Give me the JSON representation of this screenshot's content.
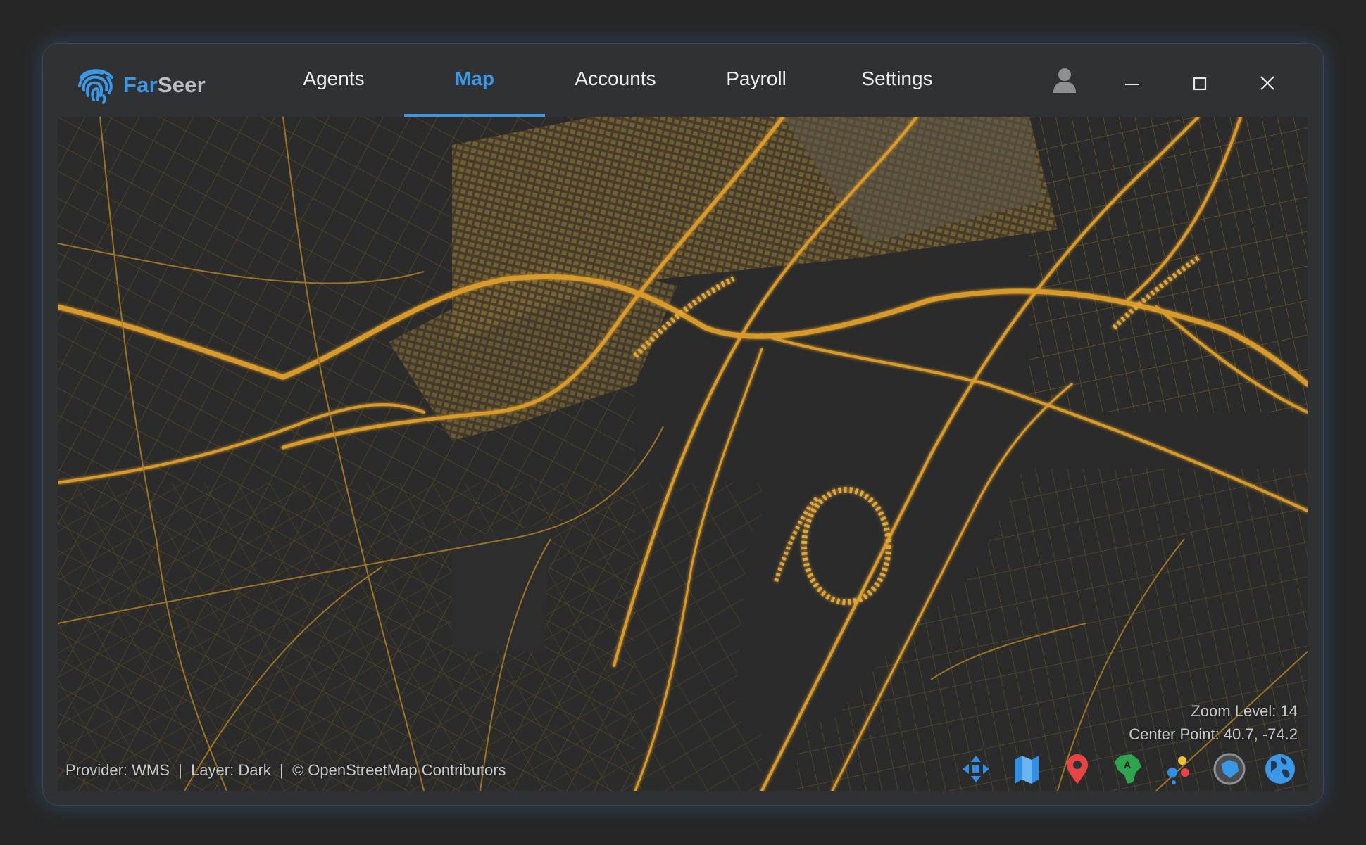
{
  "app": {
    "name_part1": "Far",
    "name_part2": "Seer",
    "brand_color": "#3a98e6"
  },
  "nav": {
    "tabs": [
      {
        "label": "Agents"
      },
      {
        "label": "Map"
      },
      {
        "label": "Accounts"
      },
      {
        "label": "Payroll"
      },
      {
        "label": "Settings"
      }
    ],
    "active": "Map"
  },
  "window_controls": {
    "icons": [
      "user-icon",
      "minimize-icon",
      "maximize-icon",
      "close-icon"
    ]
  },
  "map": {
    "zoom_label": "Zoom Level: 14",
    "center_label": "Center Point: 40.7, -74.2",
    "attribution": "Provider: WMS  |  Layer: Dark  |  © OpenStreetMap Contributors",
    "road_color": "#c8952a",
    "background_color": "#2b2b2b"
  },
  "tools": [
    "pan-icon",
    "map-icon",
    "marker-icon",
    "region-label-icon",
    "cluster-icon",
    "route-icon",
    "globe-icon"
  ]
}
